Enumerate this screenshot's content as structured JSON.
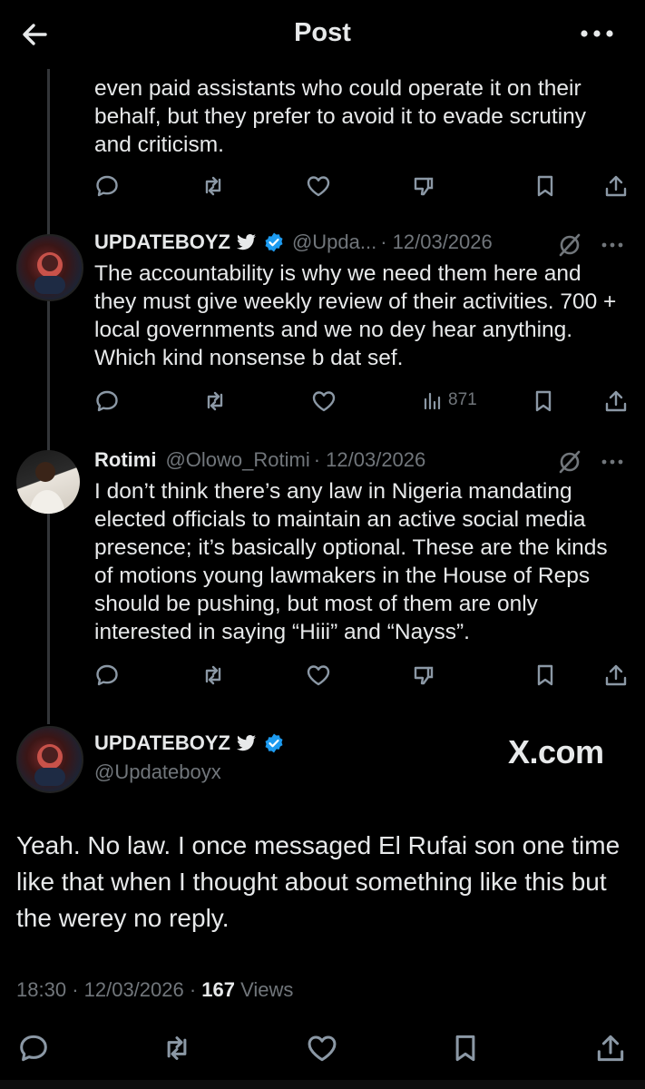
{
  "header": {
    "title": "Post"
  },
  "reply0": {
    "text": "even paid assistants who could operate it on their behalf, but they prefer to avoid it to evade scrutiny and criticism."
  },
  "reply1": {
    "name": "UPDATEBOYZ",
    "handle": "@Upda...",
    "date": "· 12/03/2026",
    "text": "The accountability is why we need them here and they must give weekly review of their activities. 700 + local governments and we no dey hear anything. Which kind nonsense b dat sef.",
    "views": "871"
  },
  "reply2": {
    "name": "Rotimi",
    "handle": "@Olowo_Rotimi",
    "date": "· 12/03/2026",
    "text": "I don’t think there’s any law in Nigeria mandating elected officials to maintain an active social media presence; it’s basically optional. These are the kinds of motions young lawmakers in the House of Reps should be pushing, but most of them are only interested in saying “Hiii” and “Nayss”."
  },
  "main": {
    "name": "UPDATEBOYZ",
    "handle": "@Updateboyx",
    "watermark": "X.com",
    "text": "Yeah. No law. I once messaged El Rufai son one time like that when I thought about something like this but the werey no reply.",
    "time": "18:30",
    "date": "· 12/03/2026 ·",
    "views_count": "167",
    "views_label": "Views"
  },
  "colors": {
    "background": "#000000",
    "text": "#e7e9ea",
    "muted": "#71767b",
    "verified": "#1d9bf0"
  },
  "icons": [
    "back-arrow-icon",
    "more-icon",
    "reply-icon",
    "repost-icon",
    "like-icon",
    "analytics-icon",
    "bookmark-icon",
    "share-icon",
    "grok-icon",
    "verified-icon",
    "bird-icon"
  ]
}
